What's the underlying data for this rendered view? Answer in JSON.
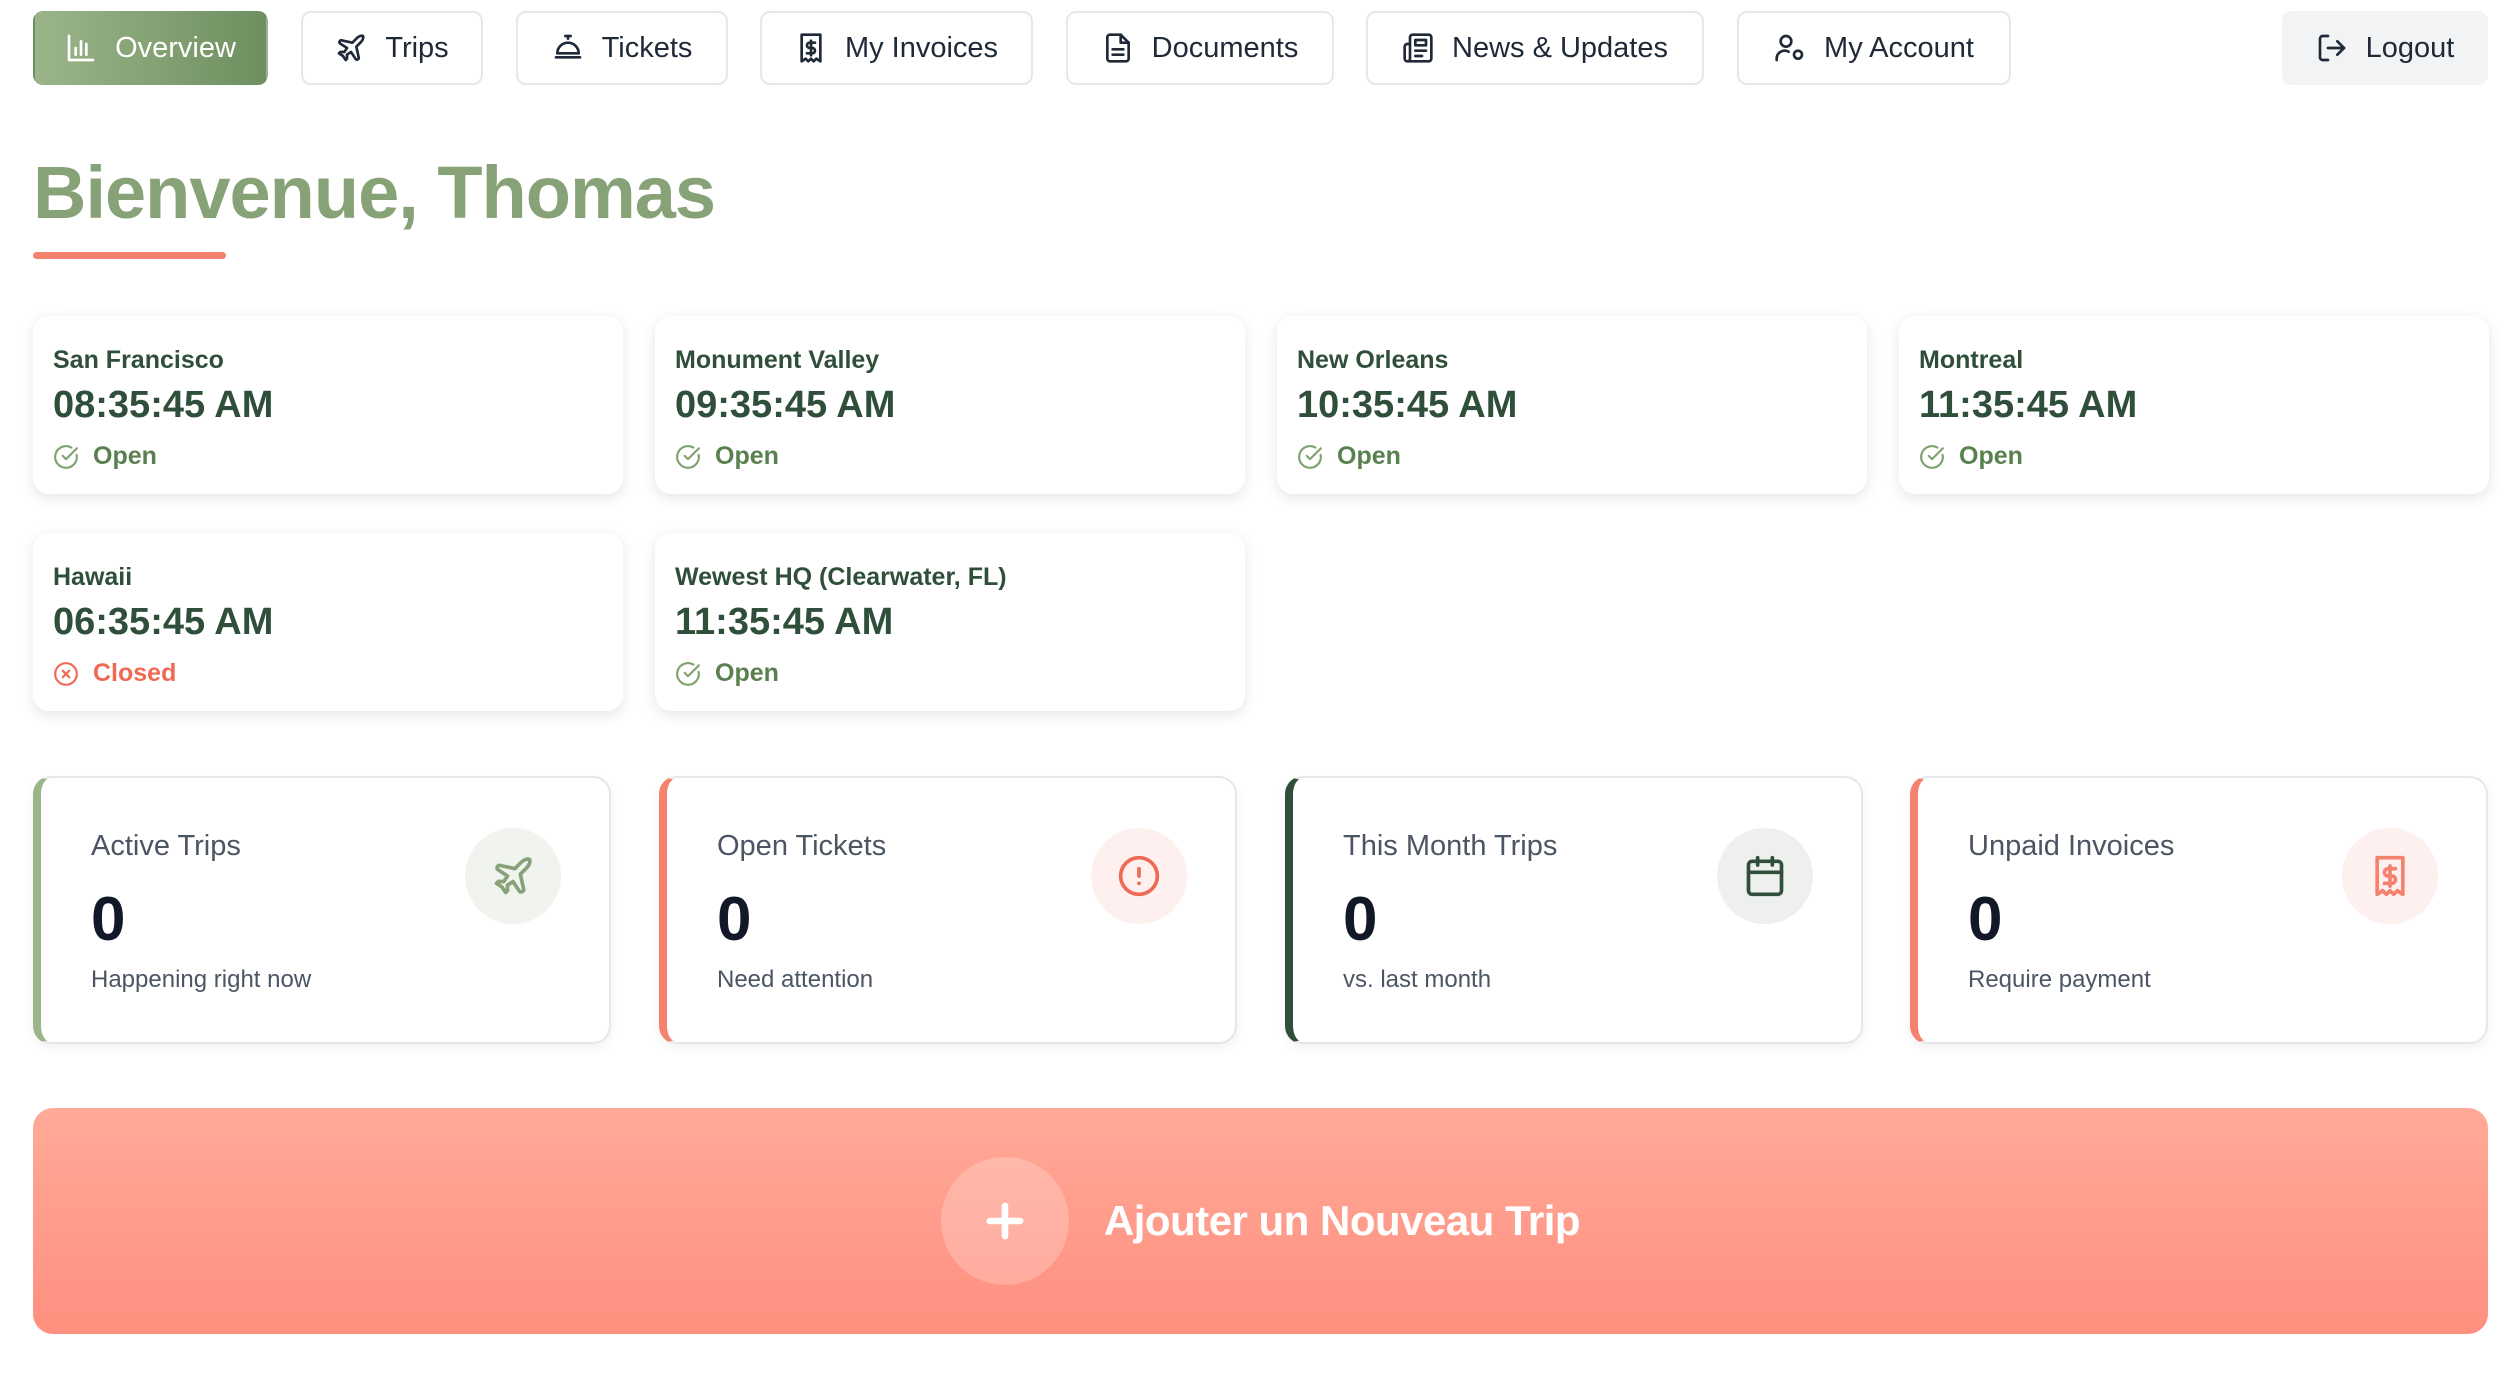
{
  "nav": {
    "overview": "Overview",
    "trips": "Trips",
    "tickets": "Tickets",
    "invoices": "My Invoices",
    "documents": "Documents",
    "news": "News & Updates",
    "account": "My Account",
    "logout": "Logout"
  },
  "greeting": "Bienvenue, Thomas",
  "clocks": [
    {
      "location": "San Francisco",
      "time": "08:35:45 AM",
      "status": "Open"
    },
    {
      "location": "Monument Valley",
      "time": "09:35:45 AM",
      "status": "Open"
    },
    {
      "location": "New Orleans",
      "time": "10:35:45 AM",
      "status": "Open"
    },
    {
      "location": "Montreal",
      "time": "11:35:45 AM",
      "status": "Open"
    },
    {
      "location": "Hawaii",
      "time": "06:35:45 AM",
      "status": "Closed"
    },
    {
      "location": "Wewest HQ (Clearwater, FL)",
      "time": "11:35:45 AM",
      "status": "Open"
    }
  ],
  "stats": [
    {
      "label": "Active Trips",
      "value": "0",
      "sub": "Happening right now",
      "icon": "plane-icon",
      "accent": "#9bb58a"
    },
    {
      "label": "Open Tickets",
      "value": "0",
      "sub": "Need attention",
      "icon": "alert-circle-icon",
      "accent": "#f5826f"
    },
    {
      "label": "This Month Trips",
      "value": "0",
      "sub": "vs. last month",
      "icon": "calendar-icon",
      "accent": "#2f4f3a"
    },
    {
      "label": "Unpaid Invoices",
      "value": "0",
      "sub": "Require payment",
      "icon": "invoice-dollar-icon",
      "accent": "#f5826f"
    }
  ],
  "cta": {
    "label": "Ajouter un Nouveau Trip"
  },
  "colors": {
    "brand_green": "#87a277",
    "brand_coral": "#f5826f",
    "dark_green": "#2f4f3a",
    "open": "#5a8050",
    "closed": "#ef6a55"
  }
}
